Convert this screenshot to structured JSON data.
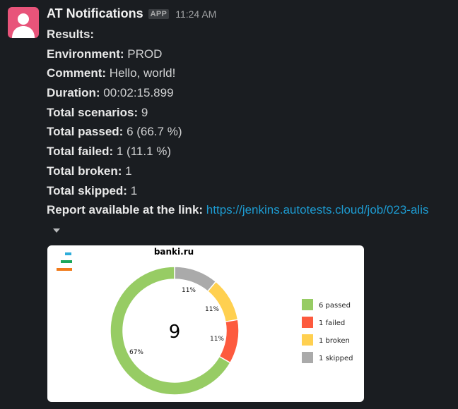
{
  "message": {
    "sender": "AT Notifications",
    "badge": "APP",
    "time": "11:24 AM"
  },
  "report": {
    "heading": "Results:",
    "rows": [
      {
        "label": "Environment:",
        "value": "PROD"
      },
      {
        "label": "Comment:",
        "value": "Hello, world!"
      },
      {
        "label": "Duration:",
        "value": "00:02:15.899"
      },
      {
        "label": "Total scenarios:",
        "value": "9"
      },
      {
        "label": "Total passed:",
        "value": "6 (66.7 %)"
      },
      {
        "label": "Total failed:",
        "value": "1 (11.1 %)"
      },
      {
        "label": "Total broken:",
        "value": "1"
      },
      {
        "label": "Total skipped:",
        "value": "1"
      }
    ],
    "link_label": "Report available at the link:",
    "link_text": "https://jenkins.autotests.cloud/job/023-alis"
  },
  "icons": {
    "collapse": "caret-down-icon",
    "logo": "allure-logo-icon"
  },
  "colors": {
    "passed": "#97cc64",
    "failed": "#fd5a3e",
    "broken": "#ffd050",
    "skipped": "#aaaaaa",
    "link": "#1d9bd1"
  },
  "chart_data": {
    "type": "pie",
    "title": "banki.ru",
    "center_label": "9",
    "slices": [
      {
        "name": "passed",
        "value": 6,
        "label": "67%",
        "legend": "6 passed",
        "color": "#97cc64"
      },
      {
        "name": "failed",
        "value": 1,
        "label": "11%",
        "legend": "1 failed",
        "color": "#fd5a3e"
      },
      {
        "name": "broken",
        "value": 1,
        "label": "11%",
        "legend": "1 broken",
        "color": "#ffd050"
      },
      {
        "name": "skipped",
        "value": 1,
        "label": "11%",
        "legend": "1 skipped",
        "color": "#aaaaaa"
      }
    ],
    "legend_position": "right"
  }
}
